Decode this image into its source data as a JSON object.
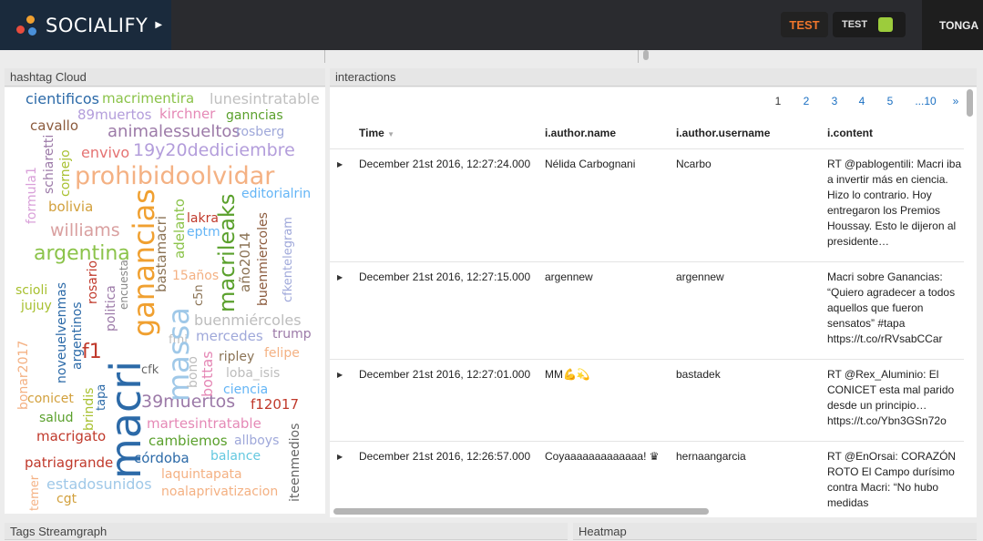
{
  "topbar": {
    "brand": "SOCIALIFY",
    "button1": "TEST",
    "button2": "TEST",
    "user": "TONGA",
    "colors": {
      "brand_bg": "#1a2a3c",
      "accent": "#f0762c",
      "swatch": "#9ccc3c"
    }
  },
  "panels": {
    "hashtag_cloud": "hashtag Cloud",
    "interactions": "interactions",
    "streamgraph": "Tags Streamgraph",
    "heatmap": "Heatmap"
  },
  "cloud_words": [
    "cientificos",
    "macrimentira",
    "lunesintratable",
    "89muertos",
    "kirchner",
    "ganncias",
    "cavallo",
    "animalessueltos",
    "rosberg",
    "envivo",
    "19y20dediciembre",
    "prohibidoolvidar",
    "schiaretti",
    "bolivia",
    "formula1",
    "editorialrin",
    "cornejo",
    "williams",
    "ganancias",
    "macrileaks",
    "lakra",
    "eptm",
    "adelanto",
    "año2014",
    "buenmiercoles",
    "cfkentelegram",
    "argentina",
    "bastamacri",
    "15años",
    "scioli",
    "jujuy",
    "rosario",
    "encuesta",
    "c5n",
    "noveuelvenmas",
    "argentinos",
    "politica",
    "massa",
    "buenmiércoles",
    "macri",
    "bonar2017",
    "fmi",
    "mercedes",
    "trump",
    "f1",
    "ripley",
    "felipe",
    "cfk",
    "bono",
    "bottas",
    "loba_isis",
    "conicet",
    "brindis",
    "tapa",
    "39muertos",
    "ciencia",
    "f12017",
    "salud",
    "martesintratable",
    "macrigato",
    "cambiemos",
    "allboys",
    "córdoba",
    "balance",
    "iteenmedios",
    "patriagrande",
    "laquintapata",
    "temer",
    "estadosunidos",
    "cgt",
    "noalaprivatizacion"
  ],
  "pagination": [
    "1",
    "2",
    "3",
    "4",
    "5",
    "...10",
    "»"
  ],
  "table": {
    "columns": [
      "Time",
      "i.author.name",
      "i.author.username",
      "i.content"
    ],
    "rows": [
      {
        "time": "December 21st 2016, 12:27:24.000",
        "name": "Nélida Carbognani",
        "username": "Ncarbo",
        "content": "RT @pablogentili: Macri iba a invertir más en ciencia. Hizo lo contrario. Hoy entregaron los Premios Houssay. Esto le dijeron al presidente…"
      },
      {
        "time": "December 21st 2016, 12:27:15.000",
        "name": "argennew",
        "username": "argennew",
        "content": "Macri sobre Ganancias: “Quiero agradecer a todos aquellos que fueron sensatos” #tapa https://t.co/rRVsabCCar"
      },
      {
        "time": "December 21st 2016, 12:27:01.000",
        "name": "MM💪💫",
        "username": "bastadek",
        "content": "RT @Rex_Aluminio: El CONICET esta mal parido desde un principio… https://t.co/Ybn3GSn72o"
      },
      {
        "time": "December 21st 2016, 12:26:57.000",
        "name": "Coyaaaaaaaaaaaaa! ♛",
        "username": "hernaangarcia",
        "content": "RT @EnOrsai: CORAZÓN ROTO El Campo durísimo contra Macri: “No hubo medidas"
      }
    ]
  }
}
